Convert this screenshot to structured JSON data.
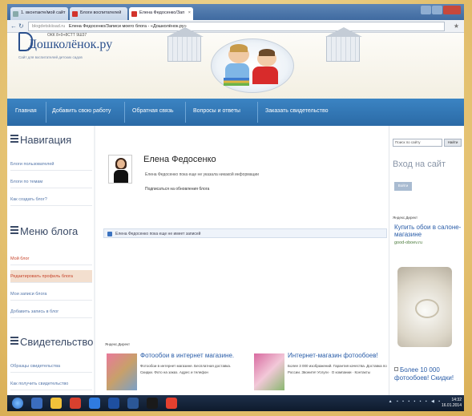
{
  "browser": {
    "tabs": [
      {
        "label": "1. вконтакте/мой сайт"
      },
      {
        "label": "Блоги воспитателей"
      },
      {
        "label": "Елена Федосенко/Зап"
      }
    ],
    "url_host": "blogdetskiisad.ru",
    "url_text": "Елена Федосенко/Записи моего блога - «Дошколёнок.ру»"
  },
  "site": {
    "phone": "ОКК 8+9+8СТТ 9Ш37",
    "logo": "Дошколёнок.ру",
    "tagline": "Сайт для воспитателей детских садов"
  },
  "nav": [
    "Главная",
    "Добавить свою работу",
    "Обратная связь",
    "Вопросы и ответы",
    "Заказать свидетельство"
  ],
  "left": {
    "nav_heading": "Навигация",
    "nav_links": [
      "Блоги пользователей",
      "Блоги по темам",
      "Как создать блог?"
    ],
    "blog_heading": "Меню блога",
    "blog_links": [
      "Мой блог",
      "Редактировать профиль блога",
      "Мои записи блога",
      "Добавить запись в блог"
    ],
    "cert_heading": "Свидетельство",
    "cert_links": [
      "Образцы свидетельства",
      "Как получить свидетельство"
    ]
  },
  "profile": {
    "name": "Елена Федосенко",
    "info": "Елена Федосенко пока еще не указала никакой информации",
    "subscribe": "Подписаться на обновления блога"
  },
  "notice": "Елена Федосенко пока еще не имеет записей",
  "ads_label": "Яндекс.Директ",
  "ads": [
    {
      "title": "Фотообои в интернет магазине.",
      "desc": "Фотообои в интернет магазине. Бесплатная доставка. Скидки. Фото на заказ. Адрес и телефон"
    },
    {
      "title": "Интернет-магазин фотообоев!",
      "desc": "Более 3 000 изображений. Гарантия качества. Доставка по России. Звоните! Услуги · О компании · Контакты"
    }
  ],
  "right": {
    "search_placeholder": "Поиск по сайту",
    "search_button": "Найти",
    "login_heading": "Вход на сайт",
    "login_button": "Войти",
    "ad_label": "Яндекс.Директ",
    "ad1_title": "Купить обои в салоне-магазине",
    "ad1_url": "good-oboev.ru",
    "ad2_title": "Более 10 000 фотообоев! Скидки!"
  },
  "taskbar": {
    "time": "14:32",
    "date": "16.01.2014"
  }
}
